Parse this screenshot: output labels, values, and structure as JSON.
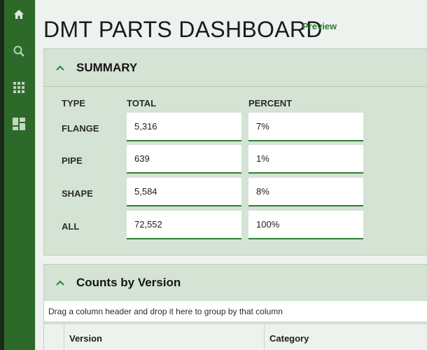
{
  "sidebar": {
    "items": [
      {
        "icon": "home-icon"
      },
      {
        "icon": "search-icon"
      },
      {
        "icon": "apps-grid-icon"
      },
      {
        "icon": "dashboard-icon"
      }
    ]
  },
  "header": {
    "title": "DMT PARTS DASHBOARD",
    "badge": "Preview"
  },
  "summary": {
    "title": "SUMMARY",
    "columns": {
      "type": "TYPE",
      "total": "TOTAL",
      "percent": "PERCENT"
    },
    "rows": [
      {
        "type": "FLANGE",
        "total": "5,316",
        "percent": "7%"
      },
      {
        "type": "PIPE",
        "total": "639",
        "percent": "1%"
      },
      {
        "type": "SHAPE",
        "total": "5,584",
        "percent": "8%"
      },
      {
        "type": "ALL",
        "total": "72,552",
        "percent": "100%"
      }
    ]
  },
  "counts": {
    "title": "Counts by Version",
    "group_hint": "Drag a column header and drop it here to group by that column",
    "columns": [
      "Version",
      "Category"
    ]
  },
  "colors": {
    "sidebar": "#2d6a2a",
    "accent": "#2e7d32",
    "panel": "#d4e3d4"
  }
}
